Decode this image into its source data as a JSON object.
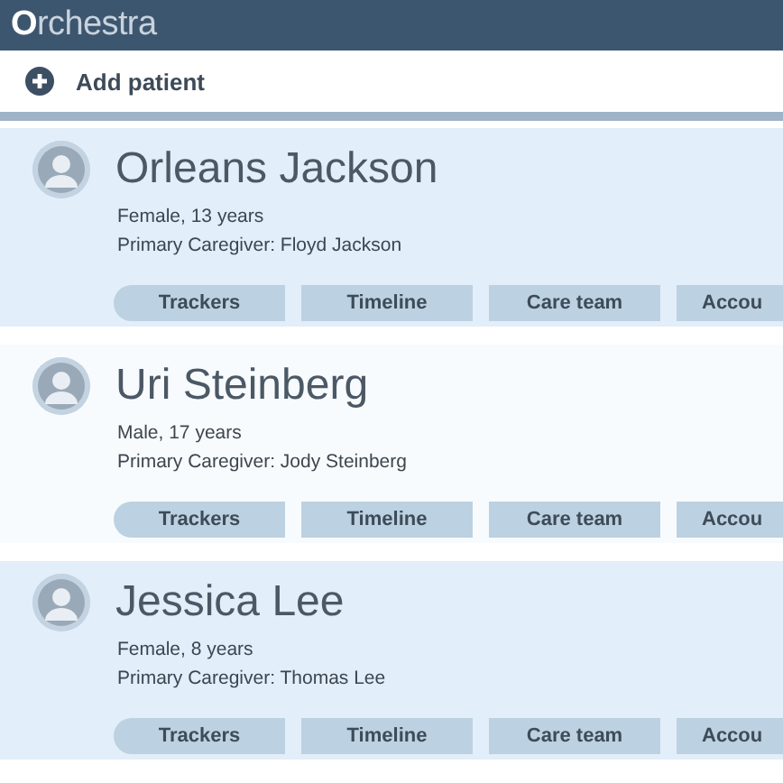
{
  "app": {
    "logo": "**O**rchestra"
  },
  "toolbar": {
    "add_button": "Add patient"
  },
  "patients": [
    {
      "name": "Orleans Jackson",
      "details": "Female, 13 years",
      "caregiver": "Primary Caregiver: Floyd Jackson",
      "tabs": [
        "Trackers",
        "Timeline",
        "Care team",
        "Accou"
      ]
    },
    {
      "name": "Uri Steinberg",
      "details": "Male, 17 years",
      "caregiver": "Primary Caregiver: Jody Steinberg",
      "tabs": [
        "Trackers",
        "Timeline",
        "Care team",
        "Accou"
      ]
    },
    {
      "name": "Jessica Lee",
      "details": "Female, 8 years",
      "caregiver": "Primary Caregiver: Thomas Lee",
      "tabs": [
        "Trackers",
        "Timeline",
        "Care team",
        "Accou"
      ]
    }
  ]
}
